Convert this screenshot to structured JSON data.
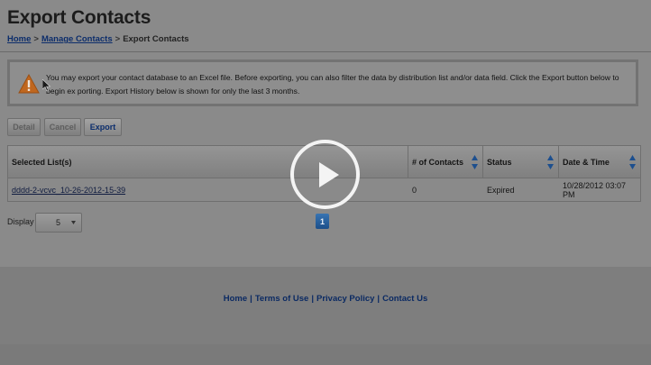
{
  "header": {
    "title": "Export Contacts",
    "breadcrumb": {
      "home": "Home",
      "sep1": ">",
      "manage": "Manage Contacts",
      "sep2": ">",
      "current": "Export Contacts"
    }
  },
  "notice": {
    "text": "You may export your contact database to an Excel file. Before exporting, you can also filter the data by distribution list and/or data field. Click the Export button below to begin ex porting. Export History below is shown for only the last 3 months."
  },
  "toolbar": {
    "detail_label": "Detail",
    "cancel_label": "Cancel",
    "export_label": "Export"
  },
  "table": {
    "headers": [
      "Selected List(s)",
      "# of Contacts",
      "Status",
      "Date & Time"
    ],
    "rows": [
      [
        "dddd-2-vcvc_10-26-2012-15-39",
        "0",
        "Expired",
        "10/28/2012 03:07 PM"
      ]
    ]
  },
  "display": {
    "label": "Display",
    "selected": "5"
  },
  "pagination": {
    "current": "1"
  },
  "footer": {
    "home": "Home",
    "terms": "Terms of Use",
    "privacy": "Privacy Policy",
    "contact": "Contact Us",
    "separator": "|"
  },
  "colors": {
    "link": "#0c2d6b",
    "pager": "#1c4f8a",
    "warning": "#c0671f"
  },
  "icons": {
    "warning": "warning-icon",
    "play": "play-icon",
    "sort": "sort-arrows-icon",
    "caret": "chevron-down-icon"
  }
}
